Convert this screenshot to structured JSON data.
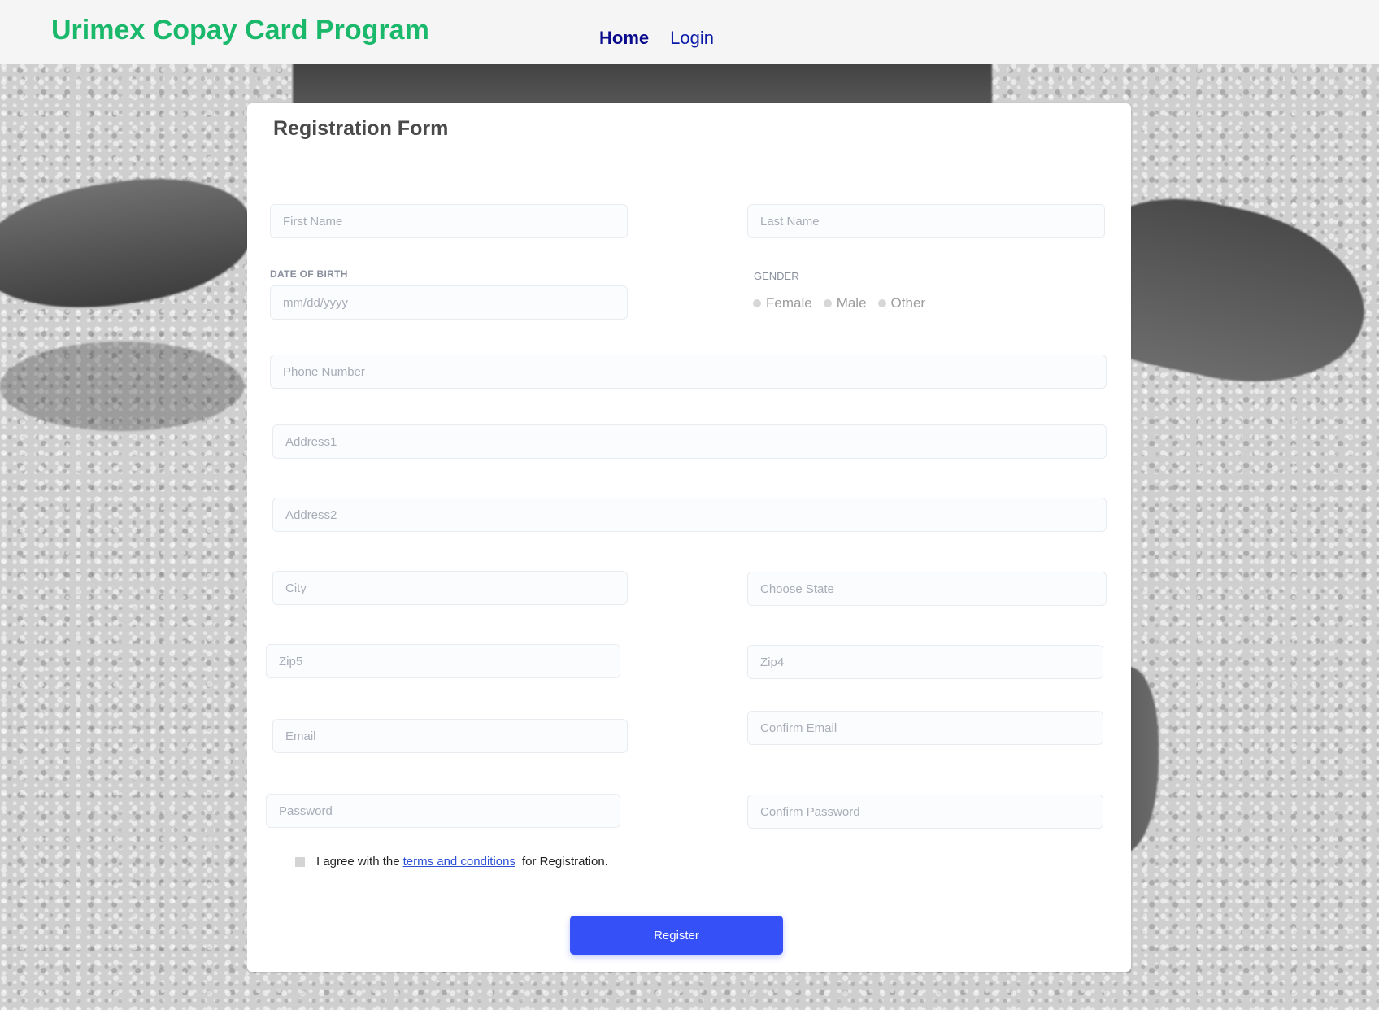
{
  "header": {
    "brand": "Urimex Copay Card Program",
    "nav": [
      {
        "label": "Home",
        "active": true
      },
      {
        "label": "Login",
        "active": false
      }
    ]
  },
  "form": {
    "title": "Registration Form",
    "first_name": {
      "placeholder": "First Name",
      "value": ""
    },
    "last_name": {
      "placeholder": "Last Name",
      "value": ""
    },
    "dob_label": "DATE OF BIRTH",
    "dob": {
      "placeholder": "mm/dd/yyyy",
      "value": ""
    },
    "gender_label": "GENDER",
    "gender_options": [
      "Female",
      "Male",
      "Other"
    ],
    "phone": {
      "placeholder": "Phone Number",
      "value": ""
    },
    "address1": {
      "placeholder": "Address1",
      "value": ""
    },
    "address2": {
      "placeholder": "Address2",
      "value": ""
    },
    "city": {
      "placeholder": "City",
      "value": ""
    },
    "state": {
      "placeholder": "Choose State",
      "value": ""
    },
    "zip5": {
      "placeholder": "Zip5",
      "value": ""
    },
    "zip4": {
      "placeholder": "Zip4",
      "value": ""
    },
    "email": {
      "placeholder": "Email",
      "value": ""
    },
    "confirm_email": {
      "placeholder": "Confirm Email",
      "value": ""
    },
    "password": {
      "placeholder": "Password",
      "value": ""
    },
    "confirm_password": {
      "placeholder": "Confirm Password",
      "value": ""
    },
    "terms_prefix": "I agree with the",
    "terms_link": "terms and conditions",
    "terms_suffix": "for Registration.",
    "register_label": "Register"
  },
  "colors": {
    "brand": "#19b86a",
    "nav": "#0b1aa8",
    "primary_button": "#3550f7",
    "link": "#2b4fd6"
  }
}
